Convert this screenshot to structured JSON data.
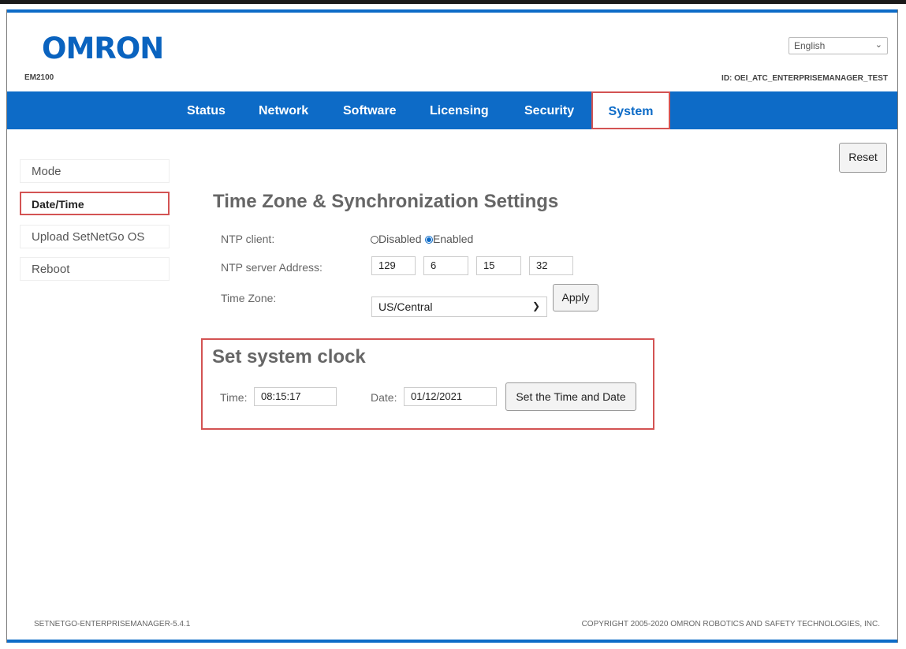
{
  "brand": {
    "logo": "OMRON",
    "model": "EM2100"
  },
  "header": {
    "language": "English",
    "device_id": "ID: OEI_ATC_ENTERPRISEMANAGER_TEST"
  },
  "nav": {
    "items": [
      {
        "label": "Status"
      },
      {
        "label": "Network"
      },
      {
        "label": "Software"
      },
      {
        "label": "Licensing"
      },
      {
        "label": "Security"
      },
      {
        "label": "System",
        "active": true
      }
    ]
  },
  "sidebar": {
    "items": [
      {
        "label": "Mode"
      },
      {
        "label": "Date/Time",
        "active": true
      },
      {
        "label": "Upload SetNetGo OS"
      },
      {
        "label": "Reboot"
      }
    ]
  },
  "reset_button": "Reset",
  "sync": {
    "title": "Time Zone & Synchronization Settings",
    "ntp_client_label": "NTP client:",
    "ntp_disabled_label": "Disabled",
    "ntp_enabled_label": "Enabled",
    "ntp_selected": "Enabled",
    "ntp_server_label": "NTP server Address:",
    "ntp_server": [
      "129",
      "6",
      "15",
      "32"
    ],
    "timezone_label": "Time Zone:",
    "timezone": "US/Central",
    "apply_button": "Apply"
  },
  "clock": {
    "title": "Set system clock",
    "time_label": "Time:",
    "time_value": "08:15:17",
    "date_label": "Date:",
    "date_value": "01/12/2021",
    "set_button": "Set the Time and Date"
  },
  "footer": {
    "version": "SETNETGO-ENTERPRISEMANAGER-5.4.1",
    "copyright": "COPYRIGHT 2005-2020 OMRON ROBOTICS AND SAFETY TECHNOLOGIES, INC."
  },
  "colors": {
    "brand_blue": "#0d6bc7",
    "highlight_red": "#d35353"
  }
}
